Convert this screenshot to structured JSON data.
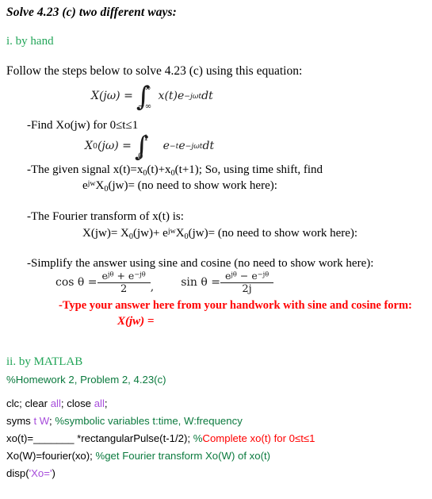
{
  "document": {
    "title": "Solve 4.23  (c) two different ways:",
    "colors": {
      "heading_green": "#22a558",
      "comment_green": "#0b7a3e",
      "keyword_purple": "#a74ddb",
      "red": "#ff0000",
      "text_black": "#000000",
      "background": "#ffffff"
    }
  },
  "part_one": {
    "heading": "i. by hand",
    "intro": "Follow the steps below to solve 4.23 (c) using this equation:",
    "equation_main": {
      "lhs": "X(jω) =",
      "integral_upper": "∞",
      "integral_lower": "−∞",
      "integrand": "x(t)e",
      "exponent": "−jωt",
      "differential": "dt"
    },
    "step1": {
      "label": "-Find Xo(jw) for 0≤t≤1",
      "equation": {
        "lhs_base": "X",
        "lhs_sub": "0",
        "lhs_rest": "(jω) =",
        "integral_upper": "1",
        "integral_lower": "0",
        "term1_base": "e",
        "term1_exp": "−t",
        "term2_base": "e",
        "term2_exp": "−jωt",
        "differential": "dt"
      }
    },
    "step2": {
      "line1_a": "-The given signal x(t)=x",
      "line1_sub1": "0",
      "line1_b": "(t)+x",
      "line1_sub2": "0",
      "line1_c": "(t+1); So, using time shift, find",
      "line2_a": "e",
      "line2_sup": "jw",
      "line2_b": "X",
      "line2_sub": "0",
      "line2_c": "(jw)= (no need to show work here):"
    },
    "step3": {
      "line1": "-The Fourier transform of x(t) is:",
      "line2_a": "X(jw)= X",
      "line2_sub1": "0",
      "line2_b": "(jw)+ e",
      "line2_sup": "jw",
      "line2_c": "X",
      "line2_sub2": "0",
      "line2_d": "(jw)= (no need to show work here):"
    },
    "step4": {
      "line1": "-Simplify the answer using sine and cosine (no need to show work here):",
      "cos_lhs": "cos θ =",
      "cos_num_a": "e",
      "cos_num_a_exp": "jθ",
      "cos_num_op": "+",
      "cos_num_b": "e",
      "cos_num_b_exp": "−jθ",
      "cos_den": "2",
      "comma": ",",
      "sin_lhs": "sin θ =",
      "sin_num_a": "e",
      "sin_num_a_exp": "jθ",
      "sin_num_op": "−",
      "sin_num_b": "e",
      "sin_num_b_exp": "−jθ",
      "sin_den": "2j"
    },
    "answer_prompt": "-Type your answer here from your handwork with sine and cosine form:",
    "answer_equation": "X(jw) ="
  },
  "part_two": {
    "heading": "ii. by MATLAB",
    "code_lines": [
      {
        "id": "line-comment-header",
        "tokens": [
          {
            "text": "%Homework 2, Problem 2, 4.23(c)",
            "kind": "comment"
          }
        ]
      },
      {
        "id": "line-clc",
        "tokens": [
          {
            "text": "clc; clear ",
            "kind": "plain"
          },
          {
            "text": "all",
            "kind": "keyword"
          },
          {
            "text": "; close ",
            "kind": "plain"
          },
          {
            "text": "all",
            "kind": "keyword"
          },
          {
            "text": ";",
            "kind": "plain"
          }
        ]
      },
      {
        "id": "line-syms",
        "tokens": [
          {
            "text": "syms ",
            "kind": "plain"
          },
          {
            "text": "t W",
            "kind": "keyword"
          },
          {
            "text": "; ",
            "kind": "plain"
          },
          {
            "text": "%symbolic variables t:time, W:frequency",
            "kind": "comment"
          }
        ]
      },
      {
        "id": "line-xot",
        "tokens": [
          {
            "text": "xo(t)=",
            "kind": "plain"
          },
          {
            "text": "_______",
            "kind": "blank"
          },
          {
            "text": " *rectangularPulse(t-1/2); ",
            "kind": "plain"
          },
          {
            "text": "%",
            "kind": "comment"
          },
          {
            "text": "Complete xo(t) for 0≤t≤1",
            "kind": "comment-red"
          }
        ]
      },
      {
        "id": "line-fourier",
        "tokens": [
          {
            "text": "Xo(W)=fourier(xo); ",
            "kind": "plain"
          },
          {
            "text": "%get Fourier transform Xo(W) of xo(t)",
            "kind": "comment"
          }
        ]
      },
      {
        "id": "line-disp",
        "tokens": [
          {
            "text": "disp(",
            "kind": "plain"
          },
          {
            "text": "'Xo='",
            "kind": "string"
          },
          {
            "text": ")",
            "kind": "plain"
          }
        ]
      }
    ]
  }
}
